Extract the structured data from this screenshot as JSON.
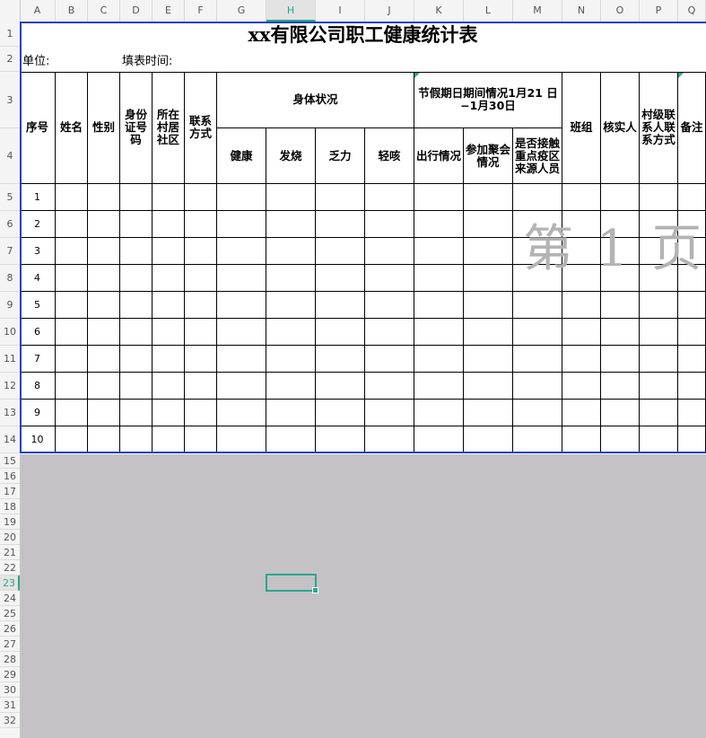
{
  "columns": [
    "A",
    "B",
    "C",
    "D",
    "E",
    "F",
    "G",
    "H",
    "I",
    "J",
    "K",
    "L",
    "M",
    "N",
    "O",
    "P",
    "Q"
  ],
  "active_column": "H",
  "rows": [
    "1",
    "2",
    "3",
    "4",
    "5",
    "6",
    "7",
    "8",
    "9",
    "10",
    "11",
    "12",
    "13",
    "14",
    "15",
    "16",
    "17",
    "18",
    "19",
    "20",
    "21",
    "22",
    "23",
    "24",
    "25",
    "26",
    "27",
    "28",
    "29",
    "30",
    "31",
    "32"
  ],
  "active_row": "23",
  "sheet": {
    "title": "xx有限公司职工健康统计表",
    "unit_label": "单位:",
    "fill_time_label": "填表时间:",
    "headers": {
      "seq": "序号",
      "name": "姓名",
      "gender": "性别",
      "id_number": "身份证号码",
      "village": "所在村居社区",
      "contact": "联系方式",
      "body_status": "身体状况",
      "holiday": "节假期日期间情况1月21 日−1月30日",
      "team": "班组",
      "verifier": "核实人",
      "village_contact": "村级联系人联系方式",
      "remark": "备注",
      "sub_healthy": "健康",
      "sub_fever": "发烧",
      "sub_fatigue": "乏力",
      "sub_cough": "轻咳",
      "sub_travel": "出行情况",
      "sub_gathering": "参加聚会情况",
      "sub_contact": "是否接触重点疫区来源人员"
    },
    "row_numbers": [
      "1",
      "2",
      "3",
      "4",
      "5",
      "6",
      "7",
      "8",
      "9",
      "10"
    ]
  },
  "watermark": "第 1 页",
  "colors": {
    "accent": "#2aa58a",
    "print_border": "#1e40c8",
    "gray_area": "#c4c2c6"
  }
}
